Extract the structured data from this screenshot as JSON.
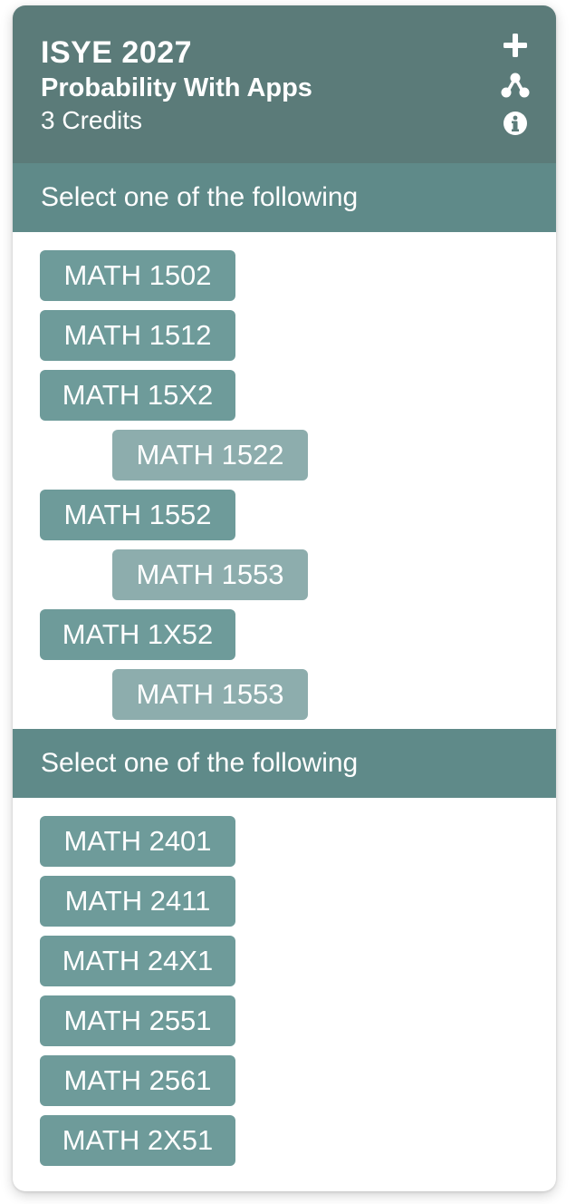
{
  "card": {
    "code": "ISYE 2027",
    "title": "Probability With Apps",
    "credits": "3 Credits"
  },
  "icons": {
    "add": "plus-icon",
    "prerequisites": "network-icon",
    "info": "info-icon"
  },
  "colors": {
    "header_bg": "#5b7b79",
    "section_bg": "#5f8a89",
    "chip_bg": "#6e9b9a",
    "sub_chip_bg": "#8dadad",
    "text": "#ffffff"
  },
  "sections": [
    {
      "label": "Select one of the following",
      "courses": [
        {
          "label": "MATH 1502",
          "nested": false
        },
        {
          "label": "MATH 1512",
          "nested": false
        },
        {
          "label": "MATH 15X2",
          "nested": false
        },
        {
          "label": "MATH 1522",
          "nested": true
        },
        {
          "label": "MATH 1552",
          "nested": false
        },
        {
          "label": "MATH 1553",
          "nested": true
        },
        {
          "label": "MATH 1X52",
          "nested": false
        },
        {
          "label": "MATH 1553",
          "nested": true
        }
      ]
    },
    {
      "label": "Select one of the following",
      "courses": [
        {
          "label": "MATH 2401",
          "nested": false
        },
        {
          "label": "MATH 2411",
          "nested": false
        },
        {
          "label": "MATH 24X1",
          "nested": false
        },
        {
          "label": "MATH 2551",
          "nested": false
        },
        {
          "label": "MATH 2561",
          "nested": false
        },
        {
          "label": "MATH 2X51",
          "nested": false
        }
      ]
    }
  ]
}
